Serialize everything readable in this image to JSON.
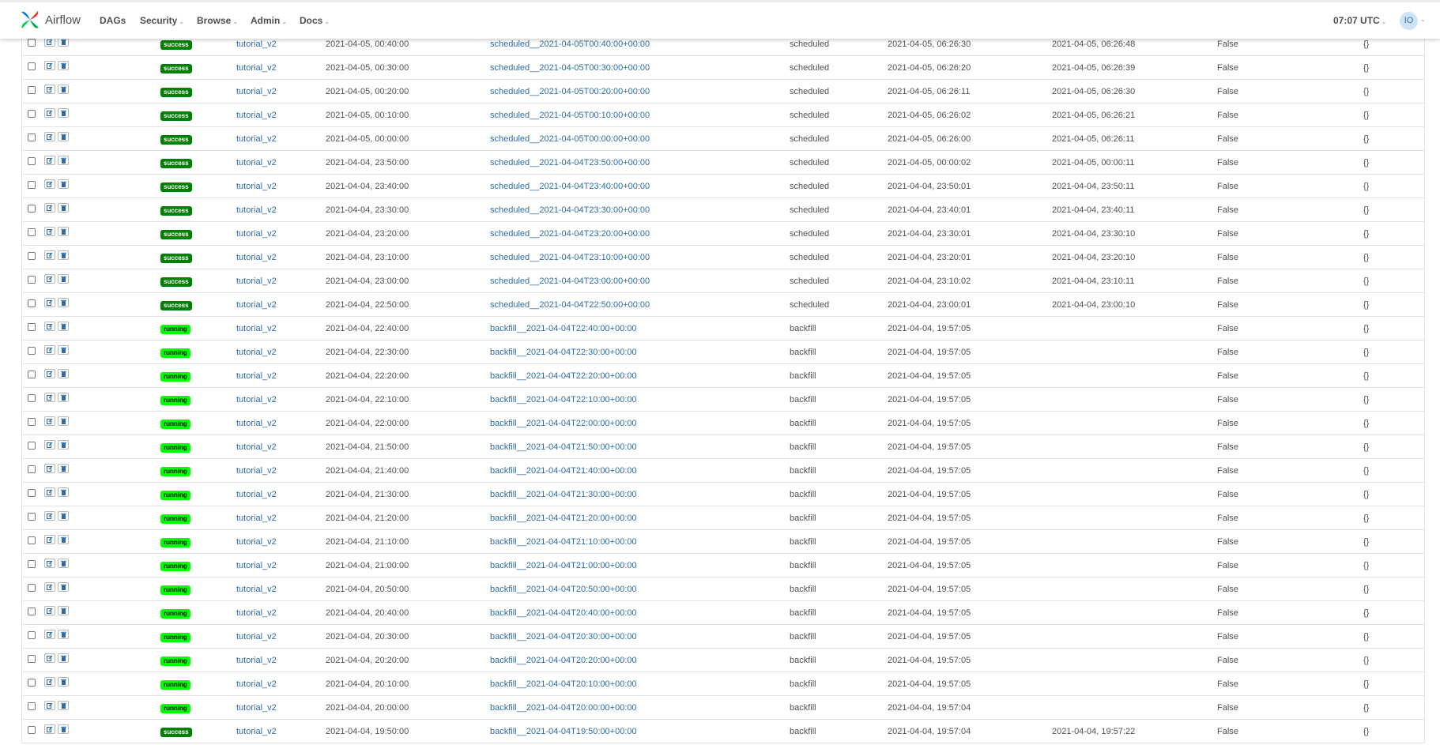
{
  "navbar": {
    "brand": "Airflow",
    "menu": [
      {
        "label": "DAGs",
        "has_caret": false
      },
      {
        "label": "Security",
        "has_caret": true
      },
      {
        "label": "Browse",
        "has_caret": true
      },
      {
        "label": "Admin",
        "has_caret": true
      },
      {
        "label": "Docs",
        "has_caret": true
      }
    ],
    "clock": "07:07 UTC",
    "user_initials": "IO"
  },
  "colors": {
    "success": "#008000",
    "running": "#00ff00",
    "link": "#2e6da4"
  },
  "rows": [
    {
      "state": "success",
      "dag_id": "tutorial_v2",
      "execution_date": "2021-04-05, 00:40:00",
      "run_id": "scheduled__2021-04-05T00:40:00+00:00",
      "run_type": "scheduled",
      "start_date": "2021-04-05, 06:26:30",
      "end_date": "2021-04-05, 06:26:48",
      "external_trigger": "False",
      "conf": "{}"
    },
    {
      "state": "success",
      "dag_id": "tutorial_v2",
      "execution_date": "2021-04-05, 00:30:00",
      "run_id": "scheduled__2021-04-05T00:30:00+00:00",
      "run_type": "scheduled",
      "start_date": "2021-04-05, 06:26:20",
      "end_date": "2021-04-05, 06:26:39",
      "external_trigger": "False",
      "conf": "{}"
    },
    {
      "state": "success",
      "dag_id": "tutorial_v2",
      "execution_date": "2021-04-05, 00:20:00",
      "run_id": "scheduled__2021-04-05T00:20:00+00:00",
      "run_type": "scheduled",
      "start_date": "2021-04-05, 06:26:11",
      "end_date": "2021-04-05, 06:26:30",
      "external_trigger": "False",
      "conf": "{}"
    },
    {
      "state": "success",
      "dag_id": "tutorial_v2",
      "execution_date": "2021-04-05, 00:10:00",
      "run_id": "scheduled__2021-04-05T00:10:00+00:00",
      "run_type": "scheduled",
      "start_date": "2021-04-05, 06:26:02",
      "end_date": "2021-04-05, 06:26:21",
      "external_trigger": "False",
      "conf": "{}"
    },
    {
      "state": "success",
      "dag_id": "tutorial_v2",
      "execution_date": "2021-04-05, 00:00:00",
      "run_id": "scheduled__2021-04-05T00:00:00+00:00",
      "run_type": "scheduled",
      "start_date": "2021-04-05, 06:26:00",
      "end_date": "2021-04-05, 06:26:11",
      "external_trigger": "False",
      "conf": "{}"
    },
    {
      "state": "success",
      "dag_id": "tutorial_v2",
      "execution_date": "2021-04-04, 23:50:00",
      "run_id": "scheduled__2021-04-04T23:50:00+00:00",
      "run_type": "scheduled",
      "start_date": "2021-04-05, 00:00:02",
      "end_date": "2021-04-05, 00:00:11",
      "external_trigger": "False",
      "conf": "{}"
    },
    {
      "state": "success",
      "dag_id": "tutorial_v2",
      "execution_date": "2021-04-04, 23:40:00",
      "run_id": "scheduled__2021-04-04T23:40:00+00:00",
      "run_type": "scheduled",
      "start_date": "2021-04-04, 23:50:01",
      "end_date": "2021-04-04, 23:50:11",
      "external_trigger": "False",
      "conf": "{}"
    },
    {
      "state": "success",
      "dag_id": "tutorial_v2",
      "execution_date": "2021-04-04, 23:30:00",
      "run_id": "scheduled__2021-04-04T23:30:00+00:00",
      "run_type": "scheduled",
      "start_date": "2021-04-04, 23:40:01",
      "end_date": "2021-04-04, 23:40:11",
      "external_trigger": "False",
      "conf": "{}"
    },
    {
      "state": "success",
      "dag_id": "tutorial_v2",
      "execution_date": "2021-04-04, 23:20:00",
      "run_id": "scheduled__2021-04-04T23:20:00+00:00",
      "run_type": "scheduled",
      "start_date": "2021-04-04, 23:30:01",
      "end_date": "2021-04-04, 23:30:10",
      "external_trigger": "False",
      "conf": "{}"
    },
    {
      "state": "success",
      "dag_id": "tutorial_v2",
      "execution_date": "2021-04-04, 23:10:00",
      "run_id": "scheduled__2021-04-04T23:10:00+00:00",
      "run_type": "scheduled",
      "start_date": "2021-04-04, 23:20:01",
      "end_date": "2021-04-04, 23:20:10",
      "external_trigger": "False",
      "conf": "{}"
    },
    {
      "state": "success",
      "dag_id": "tutorial_v2",
      "execution_date": "2021-04-04, 23:00:00",
      "run_id": "scheduled__2021-04-04T23:00:00+00:00",
      "run_type": "scheduled",
      "start_date": "2021-04-04, 23:10:02",
      "end_date": "2021-04-04, 23:10:11",
      "external_trigger": "False",
      "conf": "{}"
    },
    {
      "state": "success",
      "dag_id": "tutorial_v2",
      "execution_date": "2021-04-04, 22:50:00",
      "run_id": "scheduled__2021-04-04T22:50:00+00:00",
      "run_type": "scheduled",
      "start_date": "2021-04-04, 23:00:01",
      "end_date": "2021-04-04, 23:00:10",
      "external_trigger": "False",
      "conf": "{}"
    },
    {
      "state": "running",
      "dag_id": "tutorial_v2",
      "execution_date": "2021-04-04, 22:40:00",
      "run_id": "backfill__2021-04-04T22:40:00+00:00",
      "run_type": "backfill",
      "start_date": "2021-04-04, 19:57:05",
      "end_date": "",
      "external_trigger": "False",
      "conf": "{}"
    },
    {
      "state": "running",
      "dag_id": "tutorial_v2",
      "execution_date": "2021-04-04, 22:30:00",
      "run_id": "backfill__2021-04-04T22:30:00+00:00",
      "run_type": "backfill",
      "start_date": "2021-04-04, 19:57:05",
      "end_date": "",
      "external_trigger": "False",
      "conf": "{}"
    },
    {
      "state": "running",
      "dag_id": "tutorial_v2",
      "execution_date": "2021-04-04, 22:20:00",
      "run_id": "backfill__2021-04-04T22:20:00+00:00",
      "run_type": "backfill",
      "start_date": "2021-04-04, 19:57:05",
      "end_date": "",
      "external_trigger": "False",
      "conf": "{}"
    },
    {
      "state": "running",
      "dag_id": "tutorial_v2",
      "execution_date": "2021-04-04, 22:10:00",
      "run_id": "backfill__2021-04-04T22:10:00+00:00",
      "run_type": "backfill",
      "start_date": "2021-04-04, 19:57:05",
      "end_date": "",
      "external_trigger": "False",
      "conf": "{}"
    },
    {
      "state": "running",
      "dag_id": "tutorial_v2",
      "execution_date": "2021-04-04, 22:00:00",
      "run_id": "backfill__2021-04-04T22:00:00+00:00",
      "run_type": "backfill",
      "start_date": "2021-04-04, 19:57:05",
      "end_date": "",
      "external_trigger": "False",
      "conf": "{}"
    },
    {
      "state": "running",
      "dag_id": "tutorial_v2",
      "execution_date": "2021-04-04, 21:50:00",
      "run_id": "backfill__2021-04-04T21:50:00+00:00",
      "run_type": "backfill",
      "start_date": "2021-04-04, 19:57:05",
      "end_date": "",
      "external_trigger": "False",
      "conf": "{}"
    },
    {
      "state": "running",
      "dag_id": "tutorial_v2",
      "execution_date": "2021-04-04, 21:40:00",
      "run_id": "backfill__2021-04-04T21:40:00+00:00",
      "run_type": "backfill",
      "start_date": "2021-04-04, 19:57:05",
      "end_date": "",
      "external_trigger": "False",
      "conf": "{}"
    },
    {
      "state": "running",
      "dag_id": "tutorial_v2",
      "execution_date": "2021-04-04, 21:30:00",
      "run_id": "backfill__2021-04-04T21:30:00+00:00",
      "run_type": "backfill",
      "start_date": "2021-04-04, 19:57:05",
      "end_date": "",
      "external_trigger": "False",
      "conf": "{}"
    },
    {
      "state": "running",
      "dag_id": "tutorial_v2",
      "execution_date": "2021-04-04, 21:20:00",
      "run_id": "backfill__2021-04-04T21:20:00+00:00",
      "run_type": "backfill",
      "start_date": "2021-04-04, 19:57:05",
      "end_date": "",
      "external_trigger": "False",
      "conf": "{}"
    },
    {
      "state": "running",
      "dag_id": "tutorial_v2",
      "execution_date": "2021-04-04, 21:10:00",
      "run_id": "backfill__2021-04-04T21:10:00+00:00",
      "run_type": "backfill",
      "start_date": "2021-04-04, 19:57:05",
      "end_date": "",
      "external_trigger": "False",
      "conf": "{}"
    },
    {
      "state": "running",
      "dag_id": "tutorial_v2",
      "execution_date": "2021-04-04, 21:00:00",
      "run_id": "backfill__2021-04-04T21:00:00+00:00",
      "run_type": "backfill",
      "start_date": "2021-04-04, 19:57:05",
      "end_date": "",
      "external_trigger": "False",
      "conf": "{}"
    },
    {
      "state": "running",
      "dag_id": "tutorial_v2",
      "execution_date": "2021-04-04, 20:50:00",
      "run_id": "backfill__2021-04-04T20:50:00+00:00",
      "run_type": "backfill",
      "start_date": "2021-04-04, 19:57:05",
      "end_date": "",
      "external_trigger": "False",
      "conf": "{}"
    },
    {
      "state": "running",
      "dag_id": "tutorial_v2",
      "execution_date": "2021-04-04, 20:40:00",
      "run_id": "backfill__2021-04-04T20:40:00+00:00",
      "run_type": "backfill",
      "start_date": "2021-04-04, 19:57:05",
      "end_date": "",
      "external_trigger": "False",
      "conf": "{}"
    },
    {
      "state": "running",
      "dag_id": "tutorial_v2",
      "execution_date": "2021-04-04, 20:30:00",
      "run_id": "backfill__2021-04-04T20:30:00+00:00",
      "run_type": "backfill",
      "start_date": "2021-04-04, 19:57:05",
      "end_date": "",
      "external_trigger": "False",
      "conf": "{}"
    },
    {
      "state": "running",
      "dag_id": "tutorial_v2",
      "execution_date": "2021-04-04, 20:20:00",
      "run_id": "backfill__2021-04-04T20:20:00+00:00",
      "run_type": "backfill",
      "start_date": "2021-04-04, 19:57:05",
      "end_date": "",
      "external_trigger": "False",
      "conf": "{}"
    },
    {
      "state": "running",
      "dag_id": "tutorial_v2",
      "execution_date": "2021-04-04, 20:10:00",
      "run_id": "backfill__2021-04-04T20:10:00+00:00",
      "run_type": "backfill",
      "start_date": "2021-04-04, 19:57:05",
      "end_date": "",
      "external_trigger": "False",
      "conf": "{}"
    },
    {
      "state": "running",
      "dag_id": "tutorial_v2",
      "execution_date": "2021-04-04, 20:00:00",
      "run_id": "backfill__2021-04-04T20:00:00+00:00",
      "run_type": "backfill",
      "start_date": "2021-04-04, 19:57:04",
      "end_date": "",
      "external_trigger": "False",
      "conf": "{}"
    },
    {
      "state": "success",
      "dag_id": "tutorial_v2",
      "execution_date": "2021-04-04, 19:50:00",
      "run_id": "backfill__2021-04-04T19:50:00+00:00",
      "run_type": "backfill",
      "start_date": "2021-04-04, 19:57:04",
      "end_date": "2021-04-04, 19:57:22",
      "external_trigger": "False",
      "conf": "{}"
    }
  ]
}
